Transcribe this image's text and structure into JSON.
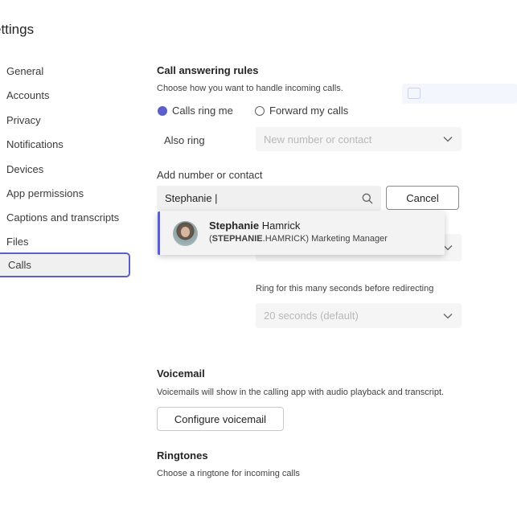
{
  "page": {
    "title": "ettings"
  },
  "nav": {
    "items": [
      {
        "label": "General"
      },
      {
        "label": "Accounts"
      },
      {
        "label": "Privacy"
      },
      {
        "label": "Notifications"
      },
      {
        "label": "Devices"
      },
      {
        "label": "App permissions"
      },
      {
        "label": "Captions and transcripts"
      },
      {
        "label": "Files"
      },
      {
        "label": "Calls",
        "selected": true
      }
    ]
  },
  "call_answering": {
    "heading": "Call answering rules",
    "description": "Choose how you want to handle incoming calls.",
    "options": [
      {
        "label": "Calls ring me",
        "selected": true
      },
      {
        "label": "Forward my calls",
        "selected": false
      }
    ],
    "also_ring_label": "Also ring",
    "also_ring_placeholder": "New number or contact",
    "add_contact_label": "Add number or contact",
    "search_value": "Stephanie |",
    "cancel_label": "Cancel",
    "suggestion": {
      "first_name": "Stephanie",
      "last_name": " Hamrick",
      "desc_open": "(",
      "desc_bold": "STEPHANIE",
      "desc_rest": ".HAMRICK) Marketing Manager"
    },
    "redirect_label": "Ring for this many seconds before redirecting",
    "redirect_value": "20 seconds (default)"
  },
  "voicemail": {
    "heading": "Voicemail",
    "description": "Voicemails will show in the calling app with audio playback and transcript.",
    "button_label": "Configure voicemail"
  },
  "ringtones": {
    "heading": "Ringtones",
    "description": "Choose a ringtone for incoming calls"
  },
  "colors": {
    "accent": "#5b5fc7",
    "field_bg": "#f5f5f5"
  },
  "icons": {
    "search": "search-icon",
    "chevron": "chevron-down-icon"
  }
}
